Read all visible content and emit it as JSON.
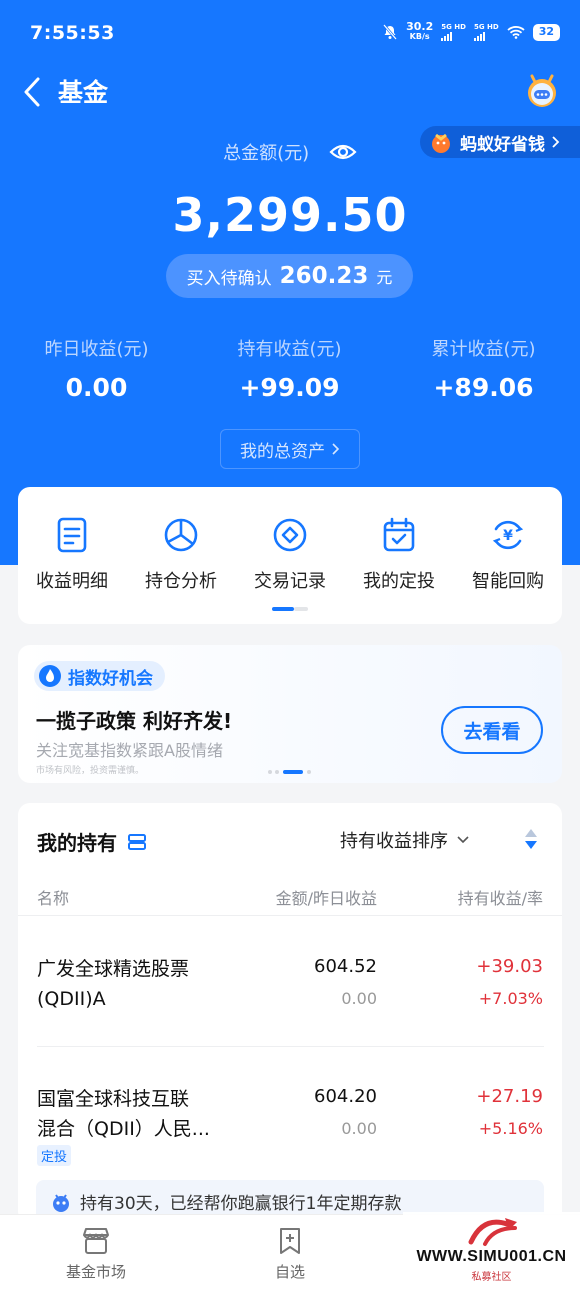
{
  "status_bar": {
    "time": "7:55:53",
    "net_speed": "30.2",
    "net_unit": "KB/s",
    "sig1": "5G HD",
    "sig2": "5G HD",
    "battery": "32"
  },
  "header": {
    "back_icon": "chevron-left-icon",
    "title": "基金",
    "mascot_icon": "ant-mascot-icon"
  },
  "promo": {
    "label": "蚂蚁好省钱"
  },
  "summary": {
    "total_label": "总金额(元)",
    "total_amount": "3,299.50",
    "pending_label": "买入待确认",
    "pending_amount": "260.23",
    "pending_unit": "元",
    "stats": [
      {
        "label": "昨日收益(元)",
        "value": "0.00"
      },
      {
        "label": "持有收益(元)",
        "value": "+99.09"
      },
      {
        "label": "累计收益(元)",
        "value": "+89.06"
      }
    ],
    "assets_btn": "我的总资产"
  },
  "quick_actions": [
    {
      "label": "收益明细",
      "icon": "document-icon"
    },
    {
      "label": "持仓分析",
      "icon": "pie-chart-icon"
    },
    {
      "label": "交易记录",
      "icon": "diamond-circle-icon"
    },
    {
      "label": "我的定投",
      "icon": "calendar-check-icon"
    },
    {
      "label": "智能回购",
      "icon": "yen-cycle-icon"
    }
  ],
  "banner": {
    "tag": "指数好机会",
    "title": "一揽子政策 利好齐发!",
    "subtitle": "关注宽基指数紧跟A股情绪",
    "risk": "市场有风险，投资需谨慎。",
    "button": "去看看"
  },
  "holdings": {
    "title": "我的持有",
    "sort_label": "持有收益排序",
    "col_name": "名称",
    "col_amount": "金额/昨日收益",
    "col_gain": "持有收益/率",
    "rows": [
      {
        "name_line1": "广发全球精选股票",
        "name_line2": "(QDII)A",
        "amount": "604.52",
        "yesterday": "0.00",
        "gain": "+39.03",
        "rate": "+7.03%",
        "tag": ""
      },
      {
        "name_line1": "国富全球科技互联",
        "name_line2": "混合（QDII）人民...",
        "amount": "604.20",
        "yesterday": "0.00",
        "gain": "+27.19",
        "rate": "+5.16%",
        "tag": "定投"
      }
    ],
    "tip": "持有30天，已经帮你跑赢银行1年定期存款"
  },
  "bottom_nav": [
    {
      "label": "基金市场",
      "icon": "store-icon"
    },
    {
      "label": "自选",
      "icon": "bookmark-plus-icon"
    }
  ],
  "watermark": {
    "text": "WWW.SIMU001.CN",
    "sub": "私募社区"
  },
  "colors": {
    "brand_blue": "#1677ff",
    "gain_red": "#e0323a"
  }
}
